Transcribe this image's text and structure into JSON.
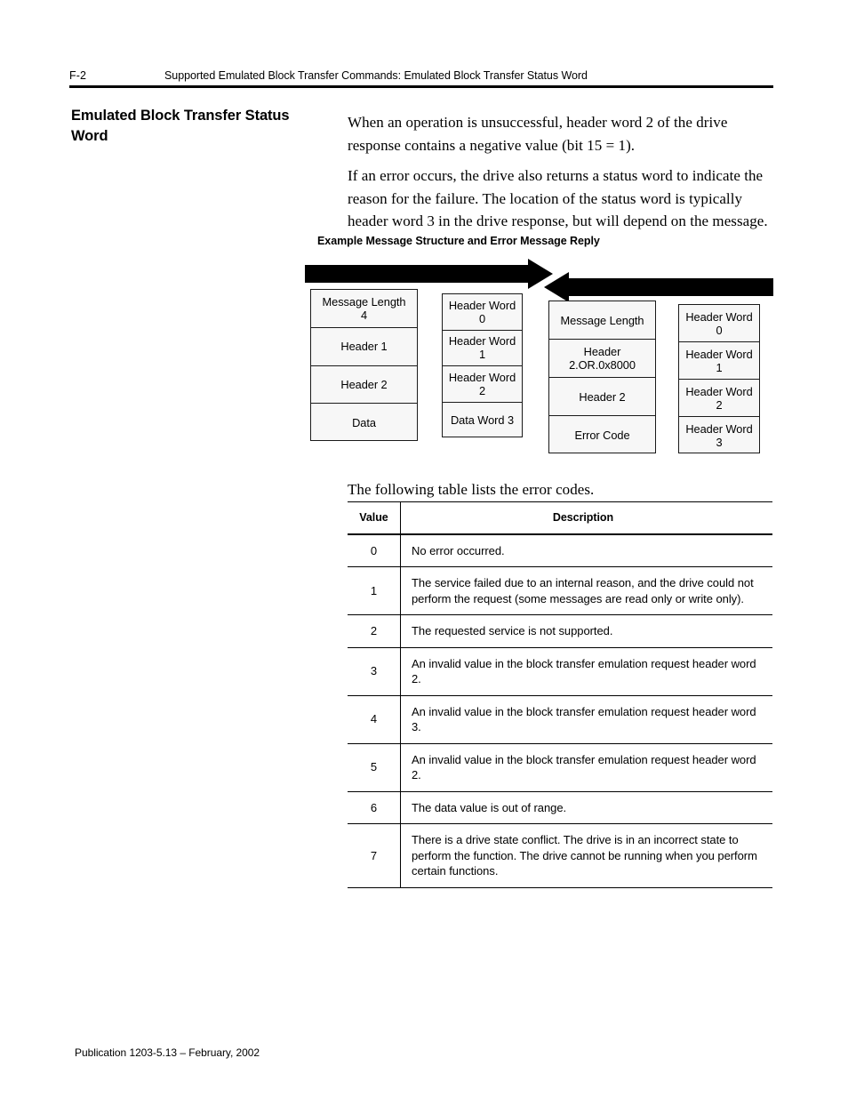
{
  "header": {
    "folio": "F-2",
    "running_head": "Supported Emulated Block Transfer Commands: Emulated Block Transfer Status Word"
  },
  "section": {
    "heading": "Emulated Block Transfer Status Word"
  },
  "body": {
    "paragraph_1": "When an operation is unsuccessful, header word 2 of the drive response contains a negative value (bit 15 = 1).",
    "paragraph_2": "If an error occurs, the drive also returns a status word to indicate the reason for the failure. The location of the status word is typically header word 3 in the drive response, but will depend on the message.",
    "paragraph_3": "The following table lists the error codes."
  },
  "figure": {
    "caption": "Example Message Structure and Error Message Reply",
    "arrow_right": "request-arrow",
    "arrow_left": "reply-arrow",
    "columns": [
      {
        "name": "request-message-structure",
        "cells": [
          {
            "line1": "Message Length",
            "line2": "4"
          },
          {
            "line1": "Header 1"
          },
          {
            "line1": "Header 2"
          },
          {
            "line1": "Data"
          }
        ]
      },
      {
        "name": "request-word-labels",
        "cells": [
          {
            "line1": "Header Word 0"
          },
          {
            "line1": "Header Word 1"
          },
          {
            "line1": "Header Word 2"
          },
          {
            "line1": "Data Word 3"
          }
        ]
      },
      {
        "name": "reply-message-structure",
        "cells": [
          {
            "line1": "Message Length"
          },
          {
            "line1": "Header 2.OR.0x8000"
          },
          {
            "line1": "Header 2"
          },
          {
            "line1": "Error Code"
          }
        ]
      },
      {
        "name": "reply-word-labels",
        "cells": [
          {
            "line1": "Header Word 0"
          },
          {
            "line1": "Header Word 1"
          },
          {
            "line1": "Header Word 2"
          },
          {
            "line1": "Header Word 3"
          }
        ]
      }
    ]
  },
  "error_table": {
    "columns": [
      "Value",
      "Description"
    ],
    "rows": [
      {
        "value": "0",
        "description": "No error occurred."
      },
      {
        "value": "1",
        "description": "The service failed due to an internal reason, and the drive could not perform the request (some messages are read only or write only)."
      },
      {
        "value": "2",
        "description": "The requested service is not supported."
      },
      {
        "value": "3",
        "description": "An invalid value in the block transfer emulation request header word 2."
      },
      {
        "value": "4",
        "description": "An invalid value in the block transfer emulation request header word 3."
      },
      {
        "value": "5",
        "description": "An invalid value in the block transfer emulation request header word 2."
      },
      {
        "value": "6",
        "description": "The data value is out of range."
      },
      {
        "value": "7",
        "description": "There is a drive state conflict. The drive is in an incorrect state to perform the function. The drive cannot be running when you perform certain functions."
      }
    ]
  },
  "footer": {
    "publication": "Publication 1203-5.13 – February, 2002"
  }
}
